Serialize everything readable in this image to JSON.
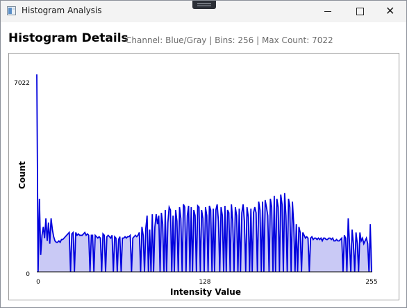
{
  "window": {
    "title": "Histogram Analysis"
  },
  "header": {
    "title": "Histogram Details",
    "subtitle": "Channel: Blue/Gray | Bins: 256 | Max Count: 7022"
  },
  "chart_data": {
    "type": "area",
    "series_color": "#0000dd",
    "fill_color": "#c9c9f5",
    "xlabel": "Intensity Value",
    "ylabel": "Count",
    "x_ticks": [
      "0",
      "128",
      "255"
    ],
    "y_ticks": [
      "0",
      "7022"
    ],
    "xlim": [
      0,
      255
    ],
    "ylim": [
      0,
      7022
    ],
    "grid": false,
    "values": [
      7022,
      0,
      2600,
      600,
      1300,
      1600,
      1200,
      1900,
      1100,
      1750,
      1000,
      1900,
      1500,
      1250,
      1100,
      1050,
      1050,
      1100,
      1050,
      1150,
      1150,
      1200,
      1250,
      1300,
      1350,
      1400,
      0,
      1350,
      1400,
      0,
      1400,
      1300,
      1350,
      1300,
      1300,
      1300,
      1350,
      1400,
      1300,
      1350,
      1300,
      0,
      1300,
      1300,
      0,
      1300,
      1250,
      1200,
      1250,
      1200,
      0,
      1350,
      1300,
      0,
      1250,
      1300,
      1250,
      1200,
      1300,
      0,
      1250,
      1200,
      0,
      1150,
      1250,
      0,
      1200,
      1200,
      1250,
      1200,
      1250,
      1250,
      1300,
      0,
      1200,
      1250,
      1300,
      1250,
      1300,
      1400,
      0,
      1600,
      1300,
      0,
      1550,
      2000,
      0,
      1500,
      0,
      2050,
      0,
      1600,
      2050,
      1700,
      2000,
      0,
      2100,
      1700,
      0,
      2200,
      0,
      1750,
      2300,
      2200,
      0,
      2000,
      0,
      2200,
      1800,
      0,
      2300,
      1900,
      0,
      2400,
      2300,
      0,
      2000,
      2350,
      0,
      2300,
      0,
      2200,
      2000,
      0,
      2350,
      2300,
      0,
      2200,
      1900,
      0,
      2300,
      2000,
      0,
      2350,
      2200,
      0,
      2250,
      0,
      2200,
      2400,
      1800,
      0,
      2300,
      2000,
      0,
      2350,
      0,
      2200,
      2100,
      0,
      2400,
      1800,
      0,
      2300,
      2000,
      0,
      2250,
      0,
      2100,
      2400,
      1800,
      0,
      2300,
      1950,
      0,
      2250,
      0,
      2100,
      2300,
      2100,
      0,
      2500,
      2200,
      0,
      2500,
      0,
      2550,
      2300,
      2000,
      0,
      2600,
      2300,
      0,
      2700,
      0,
      2600,
      2300,
      0,
      2750,
      2400,
      0,
      2800,
      2000,
      0,
      2600,
      2300,
      0,
      2500,
      1700,
      0,
      1700,
      0,
      1600,
      1400,
      0,
      1400,
      1300,
      1200,
      1250,
      1200,
      0,
      1200,
      1250,
      1150,
      1200,
      1200,
      1150,
      1200,
      1150,
      1200,
      1100,
      1200,
      1200,
      1150,
      1150,
      1200,
      1200,
      1150,
      1200,
      1100,
      1100,
      1150,
      1100,
      1100,
      1150,
      1200,
      0,
      1300,
      1200,
      0,
      1900,
      1000,
      0,
      1500,
      1000,
      0,
      1400,
      1000,
      0,
      1400,
      1100,
      1200,
      1000,
      1100,
      1200,
      1000,
      0,
      1700,
      0
    ]
  }
}
